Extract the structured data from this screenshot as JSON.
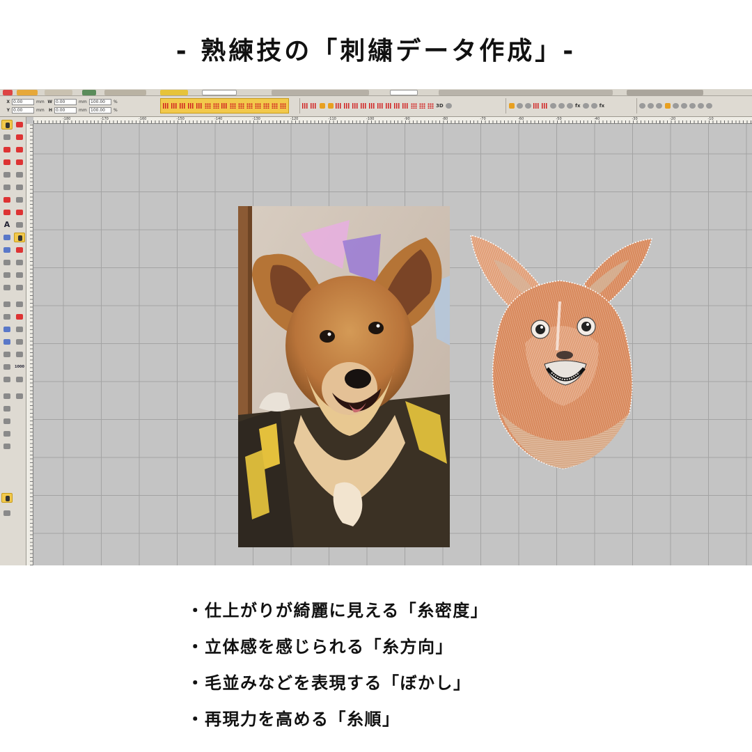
{
  "page_title": "- 熟練技の「刺繍データ作成」-",
  "app": {
    "coords": {
      "x_label": "X",
      "y_label": "Y",
      "w_label": "W",
      "h_label": "H",
      "x_value": "0.00",
      "y_value": "0.00",
      "w_value": "0.00",
      "h_value": "0.00",
      "unit": "mm",
      "scale_x": "100.00",
      "scale_y": "100.00",
      "percent": "%"
    },
    "toolbar_3d_label": "3D",
    "toolbar_fx_label": "fx",
    "ruler_labels": [
      "-180",
      "-170",
      "-160",
      "-150",
      "-140",
      "-130",
      "-120",
      "-110",
      "-100",
      "-90",
      "-80",
      "-70",
      "-60",
      "-50",
      "-40",
      "-30",
      "-20",
      "-10"
    ],
    "left_tools": {
      "text_tool": "A",
      "zoom_label": "1000"
    },
    "colors": {
      "highlight": "#f2c94c",
      "canvas": "#c4c4c4",
      "grid": "#a3a3a3",
      "toolbar": "#dedad2"
    }
  },
  "features": [
    {
      "bullet": "・",
      "text": "仕上がりが綺麗に見える「糸密度」"
    },
    {
      "bullet": "・",
      "text": "立体感を感じられる「糸方向」"
    },
    {
      "bullet": "・",
      "text": "毛並みなどを表現する「ぼかし」"
    },
    {
      "bullet": "・",
      "text": "再現力を高める「糸順」"
    }
  ]
}
